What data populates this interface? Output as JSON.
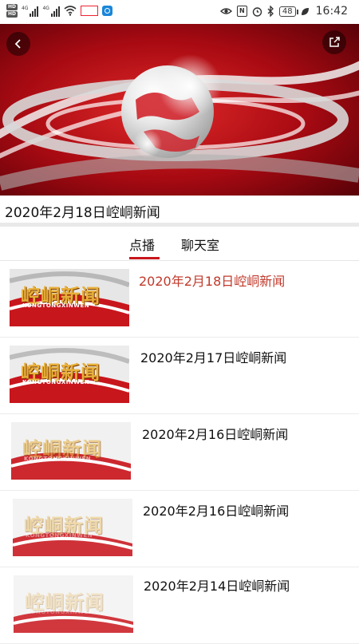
{
  "status_bar": {
    "hd_labels": [
      "HD",
      "HD"
    ],
    "network": [
      "4G",
      "4G"
    ],
    "battery": "48",
    "time": "16:42"
  },
  "player": {
    "back_icon": "chevron-left-icon",
    "share_icon": "share-icon"
  },
  "video_title": "2020年2月18日崆峒新闻",
  "tabs": [
    {
      "label": "点播",
      "active": true
    },
    {
      "label": "聊天室",
      "active": false
    }
  ],
  "list": [
    {
      "title": "2020年2月18日崆峒新闻",
      "thumb_text": "崆峒新闻",
      "thumb_sub": "KONGTONGXINWEN",
      "active": true
    },
    {
      "title": "2020年2月17日崆峒新闻",
      "thumb_text": "崆峒新闻",
      "thumb_sub": "KONGTONGXINWEN",
      "active": false
    },
    {
      "title": "2020年2月16日崆峒新闻",
      "thumb_text": "崆峒新闻",
      "thumb_sub": "KONGTONGXINWEN",
      "active": false
    },
    {
      "title": "2020年2月16日崆峒新闻",
      "thumb_text": "崆峒新闻",
      "thumb_sub": "KONGTONGXINWEN",
      "active": false
    },
    {
      "title": "2020年2月14日崆峒新闻",
      "thumb_text": "崆峒新闻",
      "thumb_sub": "KONGTONGXINWEN",
      "active": false
    }
  ],
  "colors": {
    "accent": "#c8161d",
    "active_title": "#c0392b"
  }
}
